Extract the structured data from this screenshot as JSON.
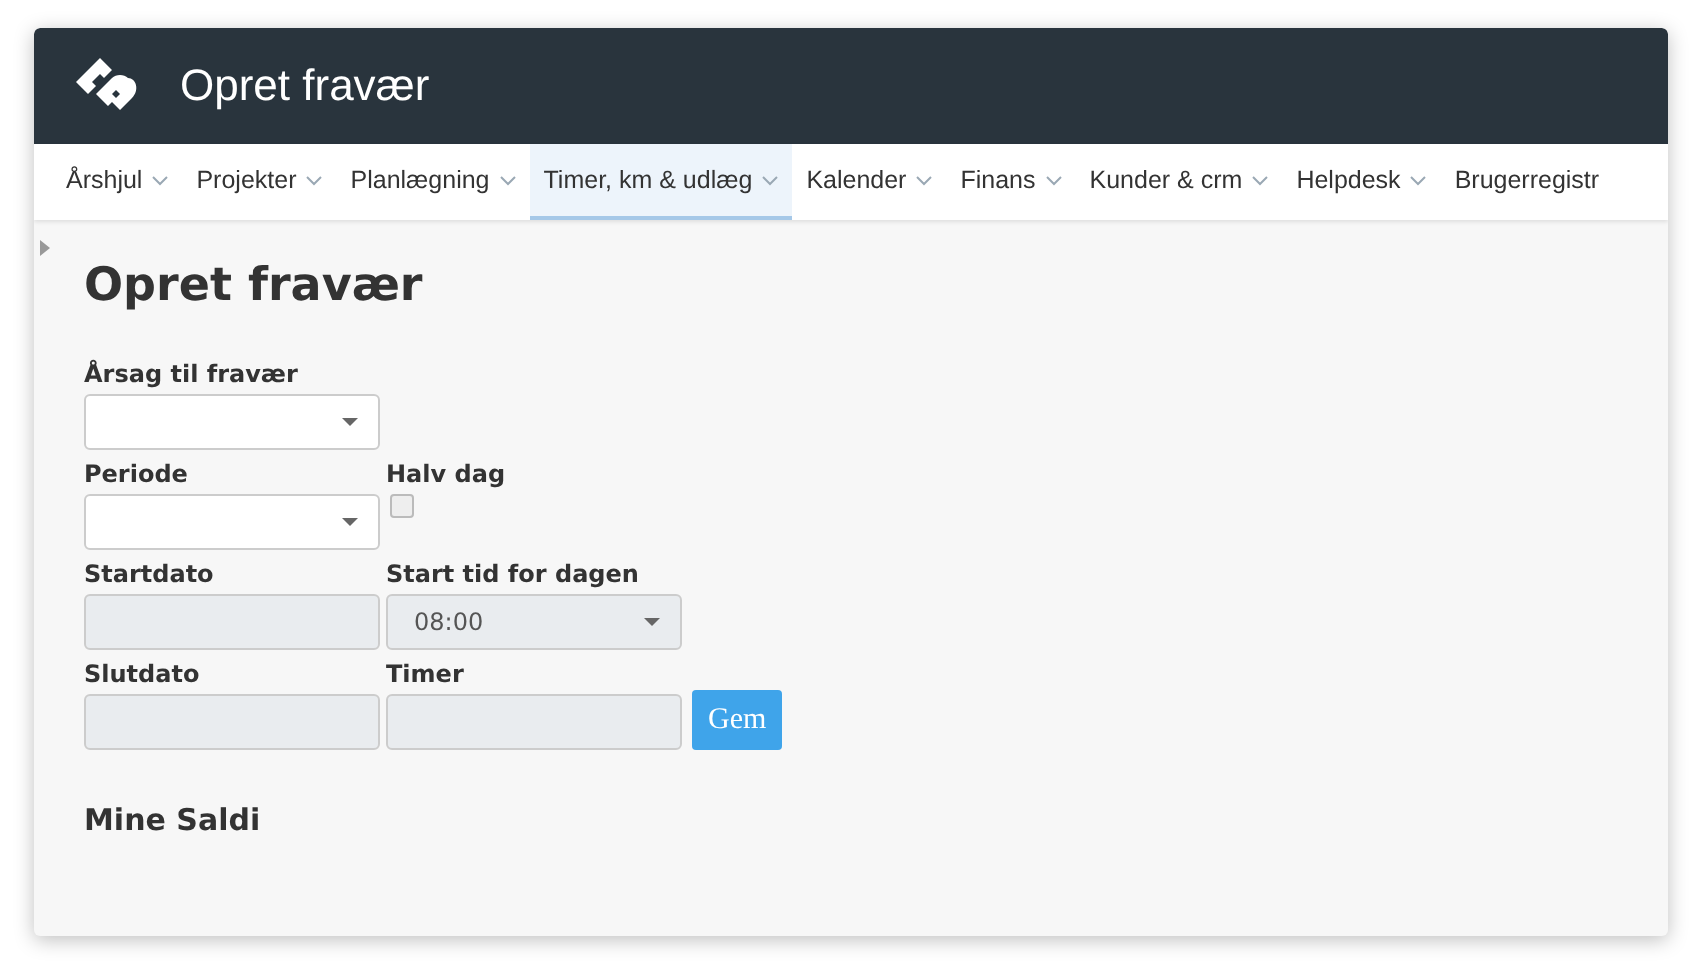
{
  "header": {
    "title": "Opret fravær"
  },
  "nav": [
    {
      "label": "Årshjul",
      "caret": true,
      "selected": false
    },
    {
      "label": "Projekter",
      "caret": true,
      "selected": false
    },
    {
      "label": "Planlægning",
      "caret": true,
      "selected": false
    },
    {
      "label": "Timer, km & udlæg",
      "caret": true,
      "selected": true
    },
    {
      "label": "Kalender",
      "caret": true,
      "selected": false
    },
    {
      "label": "Finans",
      "caret": true,
      "selected": false
    },
    {
      "label": "Kunder & crm",
      "caret": true,
      "selected": false
    },
    {
      "label": "Helpdesk",
      "caret": true,
      "selected": false
    },
    {
      "label": "Brugerregistr",
      "caret": false,
      "selected": false
    }
  ],
  "page": {
    "heading": "Opret fravær",
    "rows": [
      [
        {
          "kind": "select",
          "label": "Årsag til fravær",
          "disabled": false
        }
      ],
      [
        {
          "kind": "select",
          "label": "Periode",
          "disabled": false
        },
        {
          "kind": "checkbox",
          "label": "Halv dag",
          "checked": false
        }
      ],
      [
        {
          "kind": "input",
          "label": "Startdato",
          "disabled": true
        },
        {
          "kind": "select",
          "label": "Start tid for dagen",
          "value": "08:00",
          "disabled": true
        }
      ],
      [
        {
          "kind": "input",
          "label": "Slutdato",
          "disabled": true
        },
        {
          "kind": "input",
          "label": "Timer",
          "disabled": true
        },
        {
          "kind": "button",
          "label": "Gem"
        }
      ]
    ],
    "subheading": "Mine Saldi"
  }
}
